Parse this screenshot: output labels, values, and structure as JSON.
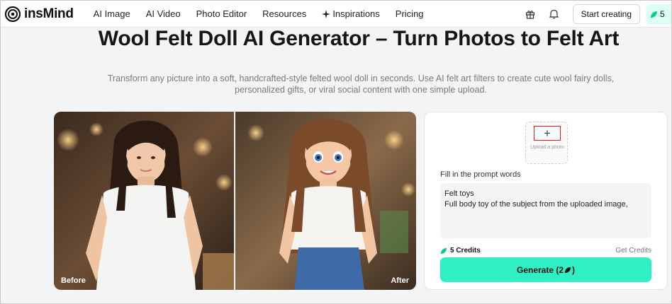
{
  "header": {
    "logo_text": "insMind",
    "nav": [
      {
        "label": "AI Image"
      },
      {
        "label": "AI Video"
      },
      {
        "label": "Photo Editor"
      },
      {
        "label": "Resources"
      },
      {
        "label": "Inspirations"
      },
      {
        "label": "Pricing"
      }
    ],
    "start_label": "Start creating",
    "credits_count": "5"
  },
  "hero": {
    "title": "Wool Felt Doll AI Generator – Turn Photos to Felt Art",
    "subtitle": "Transform any picture into a soft, handcrafted-style felted wool doll in seconds. Use AI felt art filters to create cute wool fairy dolls, personalized gifts, or viral social content with one simple upload."
  },
  "compare": {
    "before_label": "Before",
    "after_label": "After"
  },
  "panel": {
    "upload_plus": "+",
    "upload_label": "Upload a photo",
    "prompt_label": "Fill in the prompt words",
    "prompt_line1": "Felt toys",
    "prompt_line2": "Full body toy of the subject from the uploaded image,",
    "credits_label": "5 Credits",
    "get_credits_label": "Get Credits",
    "generate_label": "Generate (2",
    "generate_suffix": ")"
  },
  "colors": {
    "accent": "#2ff0c4",
    "credit_pill_bg": "#dcfff4",
    "highlight_box": "#d62020"
  }
}
